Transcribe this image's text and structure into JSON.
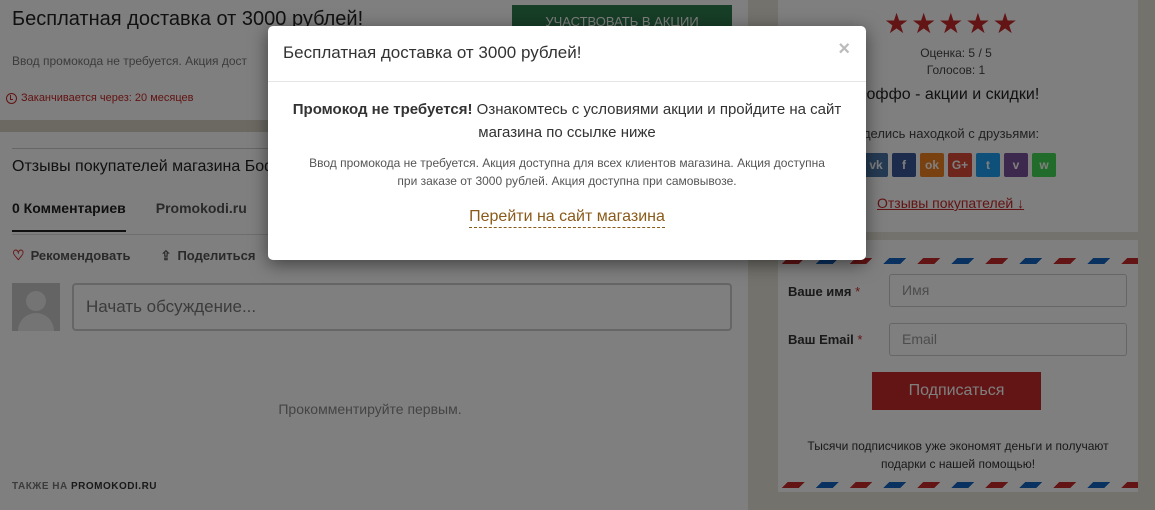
{
  "offer": {
    "title": "Бесплатная доставка от 3000 рублей!",
    "participate_label": "Участвовать в акции",
    "description": "Ввод промокода не требуется. Акция дост",
    "expires": "Заканчивается через: 20 месяцев"
  },
  "reviews": {
    "title": "Отзывы покупателей магазина Боффо",
    "tabs": [
      {
        "label": "0 Комментариев"
      },
      {
        "label": "Promokodi.ru"
      }
    ],
    "recommend_label": "Рекомендовать",
    "share_label": "Поделиться",
    "discussion_placeholder": "Начать обсуждение...",
    "empty_text": "Прокомментируйте первым.",
    "also_on_prefix": "ТАКЖЕ НА",
    "also_on_site": "PROMOKODI.RU"
  },
  "sidebar": {
    "stars": [
      "★",
      "★",
      "★",
      "★",
      "★"
    ],
    "rating_label": "Оценка: 5 / 5",
    "votes_label": "Голосов: 1",
    "shop_heading": "Боффо - акции и скидки!",
    "share_prompt": "оделись находкой с друзьями:",
    "social": [
      {
        "name": "vk",
        "glyph": "vk",
        "color": "#4a76a8"
      },
      {
        "name": "facebook",
        "glyph": "f",
        "color": "#3b5998"
      },
      {
        "name": "odnoklassniki",
        "glyph": "ok",
        "color": "#f58220"
      },
      {
        "name": "google-plus",
        "glyph": "G+",
        "color": "#dd4b39"
      },
      {
        "name": "twitter",
        "glyph": "t",
        "color": "#1da1f2"
      },
      {
        "name": "viber",
        "glyph": "v",
        "color": "#7b519d"
      },
      {
        "name": "whatsapp",
        "glyph": "w",
        "color": "#43d854"
      }
    ],
    "reviews_link": "Отзывы покупателей ↓"
  },
  "subscribe": {
    "name_label": "Ваше имя",
    "name_placeholder": "Имя",
    "email_label": "Ваш Email",
    "email_placeholder": "Email",
    "required_mark": "*",
    "button_label": "Подписаться",
    "note": "Тысячи подписчиков уже экономят деньги и получают подарки с нашей помощью!"
  },
  "modal": {
    "title": "Бесплатная доставка от 3000 рублей!",
    "close_glyph": "×",
    "lead_bold": "Промокод не требуется!",
    "lead_text": " Ознакомтесь с условиями акции и пройдите на сайт магазина по ссылке ниже",
    "note": "Ввод промокода не требуется. Акция доступна для всех клиентов магазина. Акция доступна при заказе от 3000 рублей. Акция доступна при самовывозе.",
    "link_label": "Перейти на сайт магазина"
  }
}
